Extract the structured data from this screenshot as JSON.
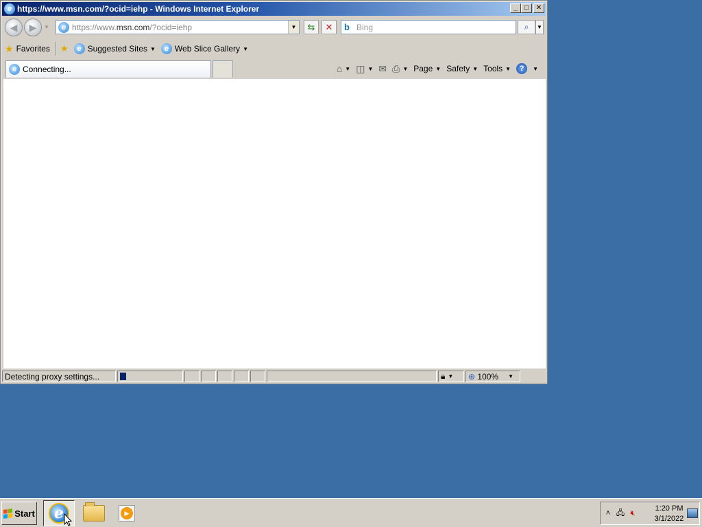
{
  "window": {
    "title": "https://www.msn.com/?ocid=iehp - Windows Internet Explorer",
    "minimize": "_",
    "maximize": "□",
    "close": "✕"
  },
  "nav": {
    "back_icon": "back-arrow-icon",
    "forward_icon": "forward-arrow-icon",
    "address_prefix": "https://www.",
    "address_domain": "msn.com",
    "address_suffix": "/?ocid=iehp",
    "search_placeholder": "Bing",
    "search_logo": "b"
  },
  "favorites": {
    "label": "Favorites",
    "items": [
      {
        "label": "Suggested Sites"
      },
      {
        "label": "Web Slice Gallery"
      }
    ]
  },
  "tab": {
    "label": "Connecting..."
  },
  "commands": {
    "page": "Page",
    "safety": "Safety",
    "tools": "Tools",
    "help": "?"
  },
  "status": {
    "text": "Detecting proxy settings...",
    "zoom": "100%"
  },
  "taskbar": {
    "start_label": "Start",
    "apps": [
      {
        "name": "internet-explorer",
        "active": true
      },
      {
        "name": "windows-explorer",
        "active": false
      },
      {
        "name": "windows-media-player",
        "active": false
      }
    ],
    "clock_time": "1:20 PM",
    "clock_date": "3/1/2022"
  },
  "colors": {
    "desktop": "#3a6ea5",
    "titlebar_start": "#0a246a",
    "chrome": "#d4d0c8"
  }
}
